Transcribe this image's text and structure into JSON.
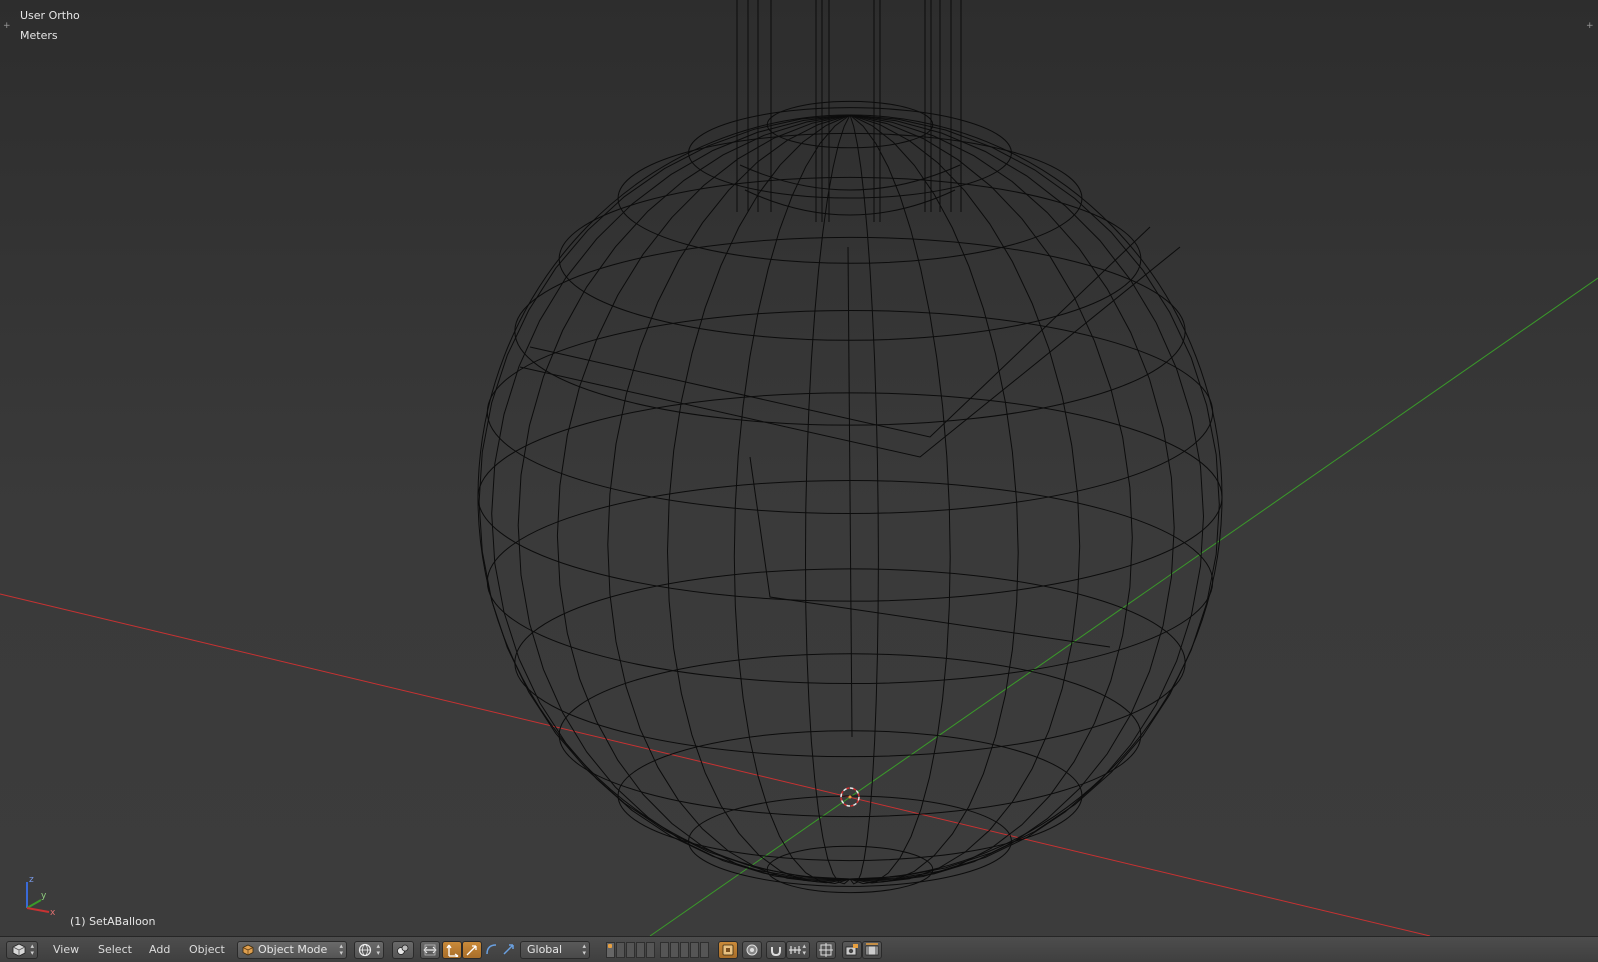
{
  "viewport": {
    "view_name": "User Ortho",
    "units": "Meters",
    "object_label": "(1) SetABalloon",
    "axis_x_color": "#c83232",
    "axis_y_color": "#3a9a2a",
    "wire_color": "#0c0c0c",
    "background_top": "#2d2d2d",
    "background_bottom": "#3c3c3c",
    "gizmo": {
      "x": "x",
      "y": "y",
      "z": "z"
    }
  },
  "header": {
    "editor_type_icon": "3d-view-icon",
    "menus": [
      "View",
      "Select",
      "Add",
      "Object"
    ],
    "mode": {
      "label": "Object Mode",
      "icon": "cube-icon"
    },
    "viewport_shading_icon": "sphere-shading-icon",
    "pivot_icon": "pivot-point-icon",
    "manipulator_icons": [
      "manipulator-toggle-icon",
      "translate-icon",
      "rotate-icon",
      "scale-icon"
    ],
    "orientation": "Global",
    "layers_active": 1,
    "snap_icons": [
      "proportional-edit-icon",
      "snap-magnet-icon",
      "snap-element-icon",
      "snap-target-icon"
    ],
    "render_icons": [
      "opengl-render-icon",
      "opengl-anim-icon"
    ]
  }
}
